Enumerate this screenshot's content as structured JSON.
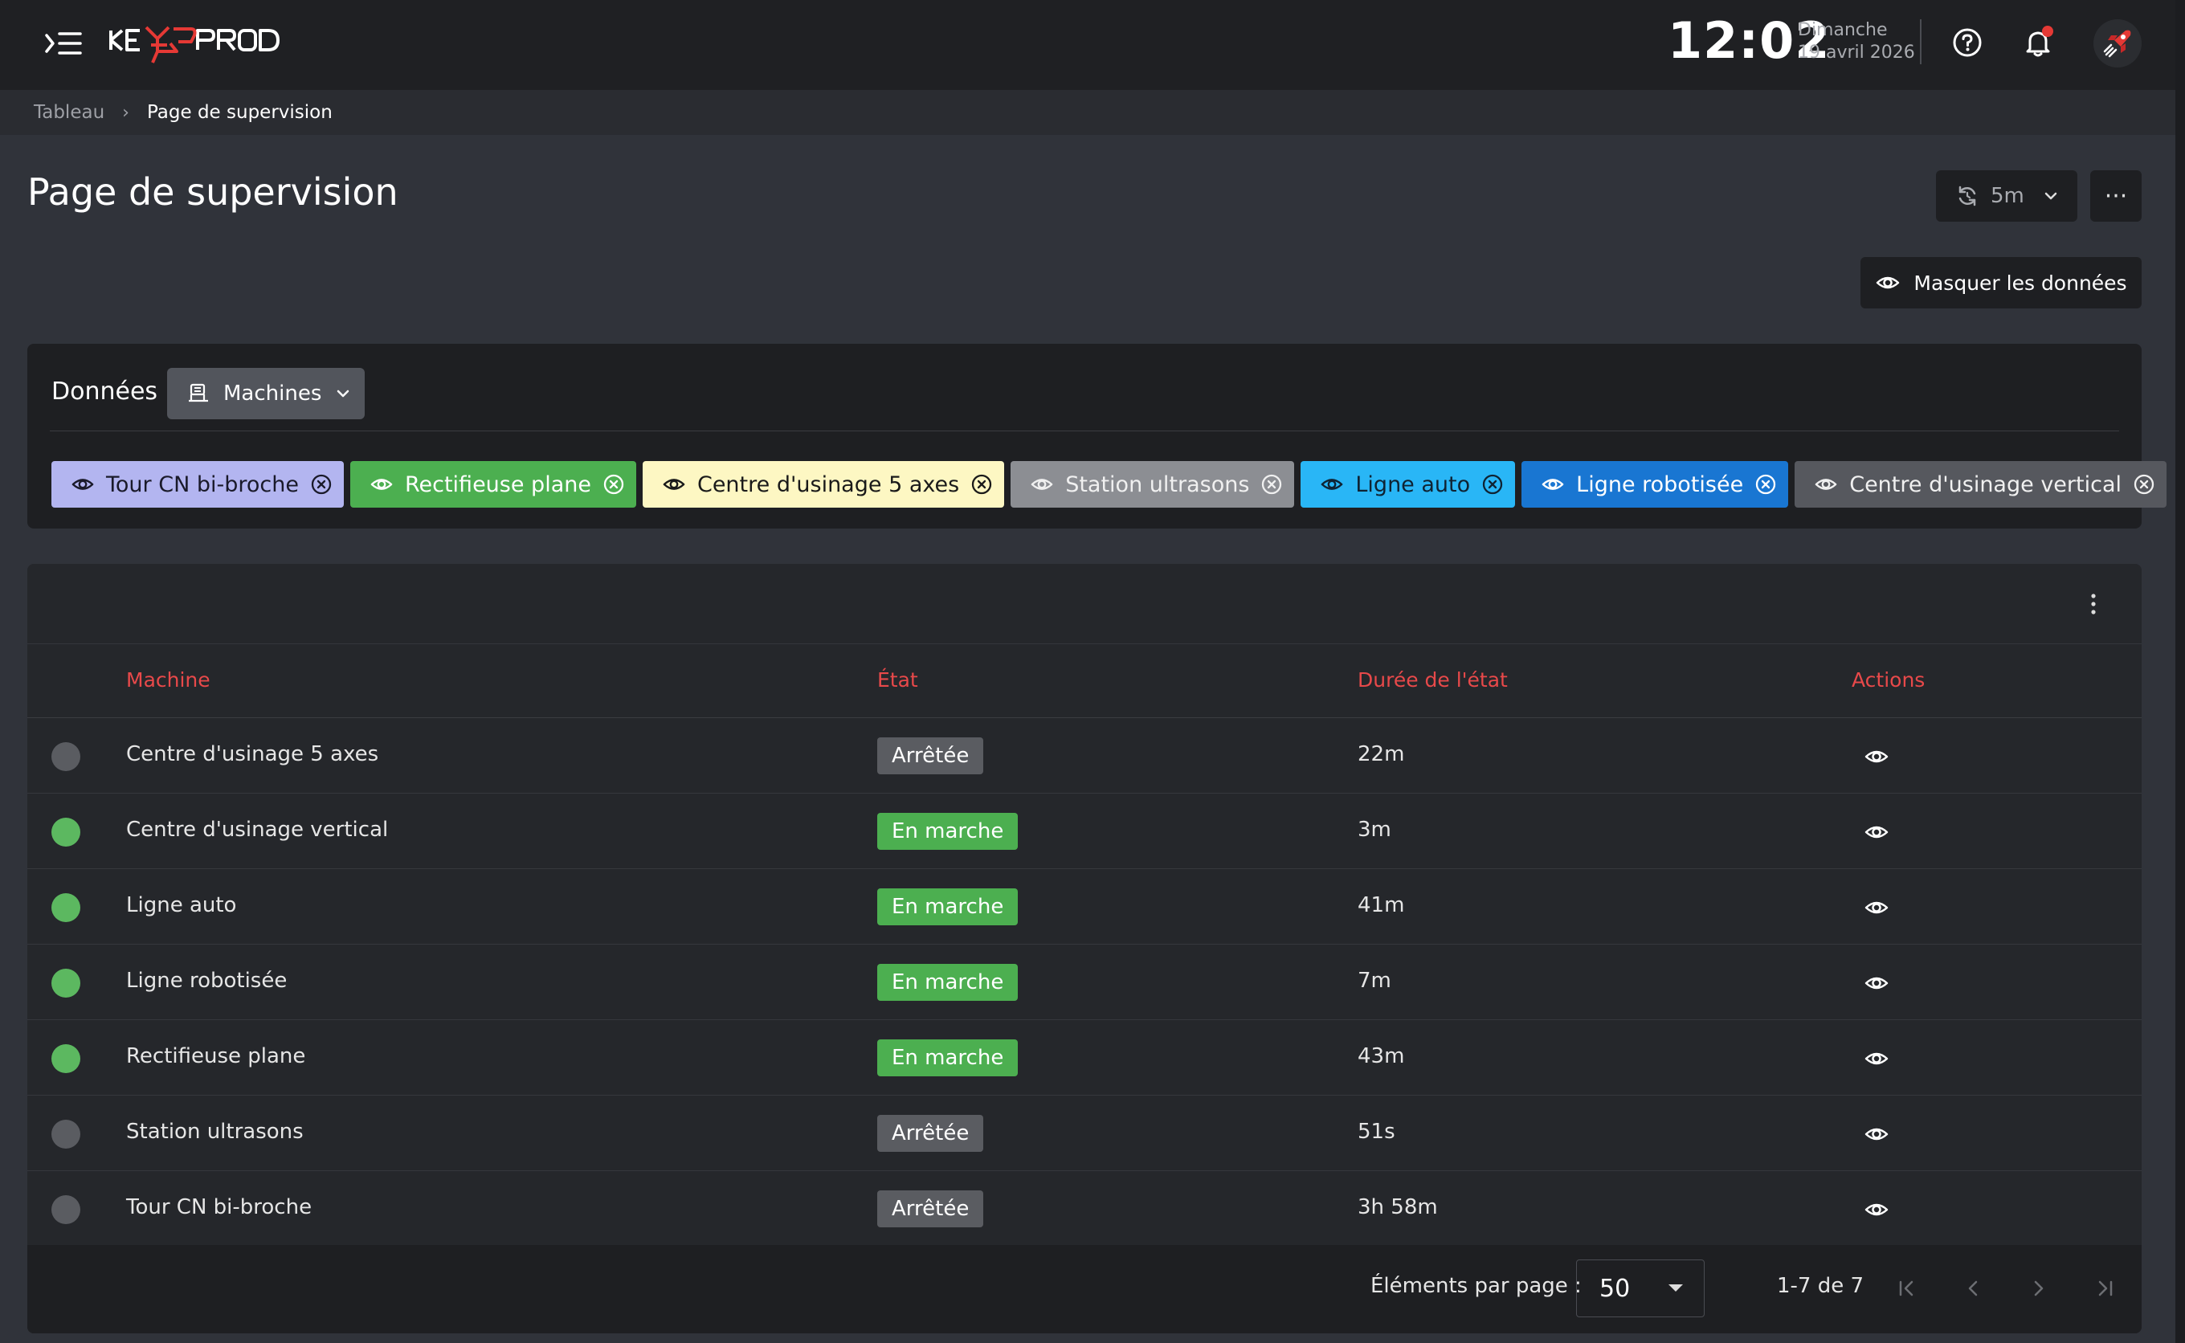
{
  "header": {
    "brand": "KEYPROD",
    "time": "12:02",
    "weekday": "Dimanche",
    "date": "19 avril 2026"
  },
  "breadcrumb": {
    "root": "Tableau",
    "separator": "›",
    "current": "Page de supervision"
  },
  "page": {
    "title": "Page de supervision",
    "refresh_interval": "5m",
    "more_label": "···",
    "mask_button": "Masquer les données"
  },
  "data_panel": {
    "label": "Données",
    "select_value": "Machines",
    "chips": [
      {
        "label": "Tour CN bi-broche",
        "bg": "#b3b5f0",
        "fg": "#1a1a2a"
      },
      {
        "label": "Rectifieuse plane",
        "bg": "#4caf50",
        "fg": "#ffffff"
      },
      {
        "label": "Centre d'usinage 5 axes",
        "bg": "#fdf7c3",
        "fg": "#1a1a1a"
      },
      {
        "label": "Station ultrasons",
        "bg": "#8c8e93",
        "fg": "#f0f0f0"
      },
      {
        "label": "Ligne auto",
        "bg": "#29b6f6",
        "fg": "#0f2333"
      },
      {
        "label": "Ligne robotisée",
        "bg": "#1976d2",
        "fg": "#ffffff"
      },
      {
        "label": "Centre d'usinage vertical",
        "bg": "#56585e",
        "fg": "#f0f0f0"
      }
    ]
  },
  "table": {
    "columns": {
      "machine": "Machine",
      "state": "État",
      "duration": "Durée de l'état",
      "actions": "Actions"
    },
    "rows": [
      {
        "machine": "Centre d'usinage 5 axes",
        "state": "Arrêtée",
        "status": "stopped",
        "duration": "22m"
      },
      {
        "machine": "Centre d'usinage vertical",
        "state": "En marche",
        "status": "running",
        "duration": "3m"
      },
      {
        "machine": "Ligne auto",
        "state": "En marche",
        "status": "running",
        "duration": "41m"
      },
      {
        "machine": "Ligne robotisée",
        "state": "En marche",
        "status": "running",
        "duration": "7m"
      },
      {
        "machine": "Rectifieuse plane",
        "state": "En marche",
        "status": "running",
        "duration": "43m"
      },
      {
        "machine": "Station ultrasons",
        "state": "Arrêtée",
        "status": "stopped",
        "duration": "51s"
      },
      {
        "machine": "Tour CN bi-broche",
        "state": "Arrêtée",
        "status": "stopped",
        "duration": "3h 58m"
      }
    ],
    "status_colors": {
      "running": "#5cb860",
      "stopped": "#5a5c61"
    }
  },
  "pagination": {
    "per_page_label": "Éléments par page :",
    "per_page_value": "50",
    "range": "1-7 de 7"
  },
  "colors": {
    "accent": "#e8494a",
    "running": "#4caf50",
    "stopped": "#5a5c61"
  }
}
